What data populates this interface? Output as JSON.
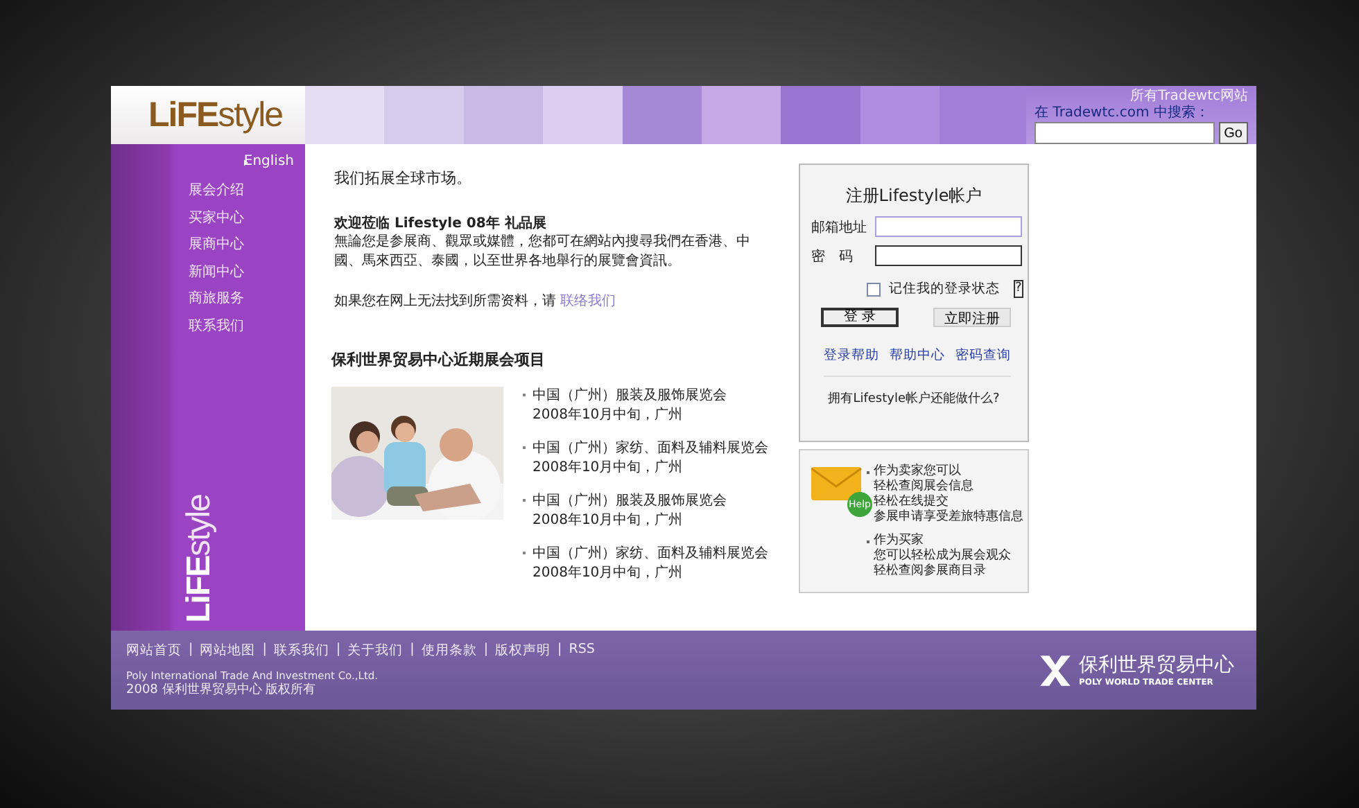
{
  "header": {
    "logo": "**LiFE**style",
    "site_link": "所有Tradewtc网站",
    "search_label": "在 Tradewtc.com 中搜索：",
    "search_button": "Go"
  },
  "sidebar": {
    "language": "English",
    "items": [
      {
        "label": "展会介绍"
      },
      {
        "label": "买家中心"
      },
      {
        "label": "展商中心"
      },
      {
        "label": "新闻中心"
      },
      {
        "label": "商旅服务"
      },
      {
        "label": "联系我们"
      }
    ],
    "logo": "**LiFE**style"
  },
  "intro": {
    "heading": "我们拓展全球市场。",
    "welcome_title": "欢迎莅临 Lifestyle 08年 礼品展",
    "welcome_text": "無論您是参展商、觀眾或媒體，您都可在網站內搜尋我們在香港、中國、馬來西亞、泰國，以至世界各地舉行的展覽會資訊。",
    "contact_text": "如果您在网上无法找到所需资料，请",
    "contact_link": "联络我们"
  },
  "events": {
    "heading": "保利世界贸易中心近期展会项目",
    "items": [
      {
        "name": "中国（广州）服装及服饰展览会",
        "date": "2008年10月中旬，广州"
      },
      {
        "name": "中国（广州）家纺、面料及辅料展览会",
        "date": "2008年10月中旬，广州"
      },
      {
        "name": "中国（广州）服装及服饰展览会",
        "date": "2008年10月中旬，广州"
      },
      {
        "name": "中国（广州）家纺、面料及辅料展览会",
        "date": "2008年10月中旬，广州"
      }
    ]
  },
  "login": {
    "title": "注册Lifestyle帐户",
    "email_label": "邮箱地址",
    "password_label": "密　码",
    "remember": {
      "label": "记住我的登录状态",
      "checked": false
    },
    "help_mark": "?",
    "login_button": "登 录",
    "register_button": "立即注册",
    "links": [
      "登录帮助",
      "帮助中心",
      "密码查询"
    ],
    "more": "拥有Lifestyle帐户还能做什么?"
  },
  "help": {
    "badge": "Help",
    "groups": [
      {
        "title": "作为卖家您可以",
        "lines": [
          "轻松查阅展会信息",
          "轻松在线提交",
          "参展申请享受差旅特惠信息"
        ]
      },
      {
        "title": "作为买家",
        "lines": [
          "您可以轻松成为展会观众",
          "轻松查阅参展商目录"
        ]
      }
    ]
  },
  "footer": {
    "links": [
      "网站首页",
      "网站地图",
      "联系我们",
      "关于我们",
      "使用条款",
      "版权声明",
      "RSS"
    ],
    "separator": "|",
    "company": "Poly International Trade And Investment Co.,Ltd.",
    "copyright": "2008 保利世界贸易中心 版权所有",
    "brand": "保利世界贸易中心",
    "brand_en": "POLY WORLD TRADE CENTER"
  }
}
